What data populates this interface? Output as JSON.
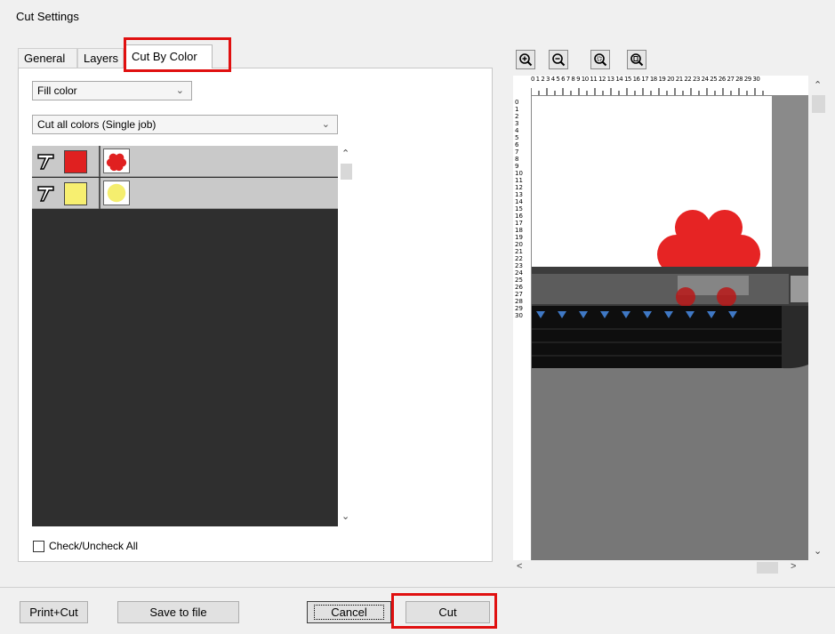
{
  "window": {
    "title": "Cut Settings"
  },
  "tabs": [
    {
      "label": "General"
    },
    {
      "label": "Layers"
    },
    {
      "label": "Cut By Color",
      "active": true
    }
  ],
  "fill_select": {
    "value": "Fill color"
  },
  "job_select": {
    "value": "Cut all colors (Single job)"
  },
  "color_list": {
    "rows": [
      {
        "color": "#e02020",
        "thumbnail": "red-flower"
      },
      {
        "color": "#f7ef70",
        "thumbnail": "yellow-circle"
      }
    ]
  },
  "check_all": {
    "label": "Check/Uncheck All",
    "checked": false
  },
  "zoom_tools": [
    "zoom-in-icon",
    "zoom-out-icon",
    "zoom-fit-icon",
    "zoom-page-icon"
  ],
  "ruler": {
    "top": "0 1 2 3 4 5 6 7 8 9 10 11 12 13 14 15 16 17 18 19 20 21 22 23 24 25 26 27 28 29 30",
    "left": [
      "0",
      "1",
      "2",
      "3",
      "4",
      "5",
      "6",
      "7",
      "8",
      "9",
      "10",
      "11",
      "12",
      "13",
      "14",
      "15",
      "16",
      "17",
      "18",
      "19",
      "20",
      "21",
      "22",
      "23",
      "24",
      "25",
      "26",
      "27",
      "28",
      "29",
      "30"
    ]
  },
  "footer": {
    "print_cut": "Print+Cut",
    "save_file": "Save to file",
    "cancel": "Cancel",
    "cut": "Cut"
  },
  "colors": {
    "highlight": "#e01010",
    "accent_blue": "#3f78c4"
  }
}
